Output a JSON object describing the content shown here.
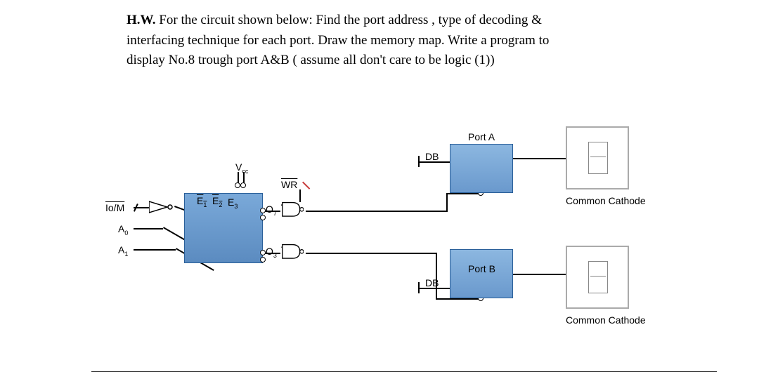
{
  "problem": {
    "label": "H.W.",
    "text1": "For the circuit shown below: Find the port address , type of decoding &",
    "text2": "interfacing technique for each port. Draw the memory map. Write a program to",
    "text3": "display No.8 trough port A&B ( assume all don't care to be logic (1))"
  },
  "circuit": {
    "inputs": {
      "iom": "Io/M",
      "a0": "A",
      "a0_sub": "0",
      "a1": "A",
      "a1_sub": "1",
      "vcc": "V",
      "vcc_sub": "cc"
    },
    "decoder": {
      "e1": "E",
      "e1_sub": "1",
      "e2": "E",
      "e2_sub": "2",
      "e3": "E",
      "e3_sub": "3",
      "wr": "WR",
      "o7": "O",
      "o7_sub": "7",
      "o3": "O",
      "o3_sub": "3"
    },
    "ports": {
      "porta": "Port A",
      "portb": "Port B",
      "db": "DB"
    },
    "displays": {
      "caption": "Common Cathode"
    }
  }
}
